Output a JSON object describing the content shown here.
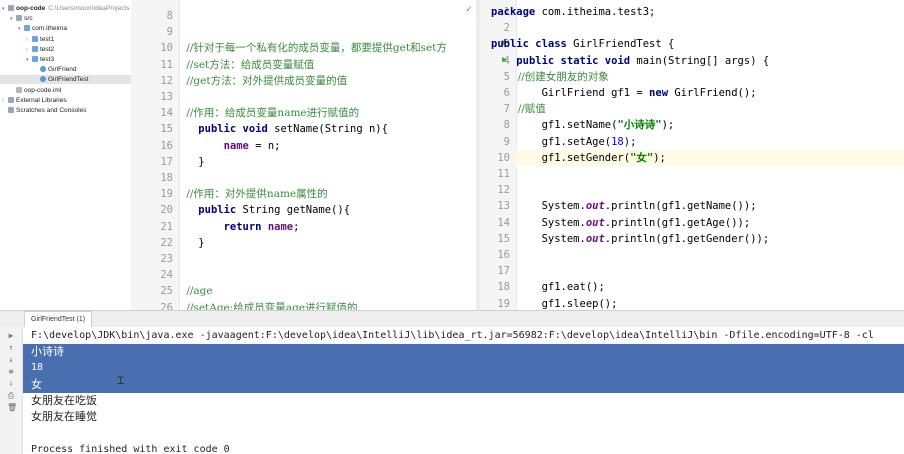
{
  "project_tree": {
    "items": [
      {
        "label": "oop-code",
        "path": "C:\\Users\\moon\\IdeaProjects",
        "indent": 0,
        "icon": "folder-icon",
        "arrow": "▾"
      },
      {
        "label": "src",
        "indent": 1,
        "icon": "folder-icon",
        "arrow": "▾"
      },
      {
        "label": "com.itheima",
        "indent": 2,
        "icon": "package-icon",
        "arrow": "▾"
      },
      {
        "label": "test1",
        "indent": 3,
        "icon": "package-icon",
        "arrow": "›"
      },
      {
        "label": "test2",
        "indent": 3,
        "icon": "package-icon",
        "arrow": "›"
      },
      {
        "label": "test3",
        "indent": 3,
        "icon": "package-icon",
        "arrow": "▾"
      },
      {
        "label": "GirlFriend",
        "indent": 4,
        "icon": "class-icon",
        "arrow": ""
      },
      {
        "label": "GirlFriendTest",
        "indent": 4,
        "icon": "class-icon",
        "arrow": "",
        "selected": true
      },
      {
        "label": "oop-code.iml",
        "indent": 1,
        "icon": "file-icon",
        "arrow": ""
      },
      {
        "label": "External Libraries",
        "indent": 0,
        "icon": "library-icon",
        "arrow": "›"
      },
      {
        "label": "Scratches and Consoles",
        "indent": 0,
        "icon": "scratch-icon",
        "arrow": ""
      }
    ]
  },
  "left_editor": {
    "line_numbers": [
      "8",
      "9",
      "10",
      "11",
      "12",
      "13",
      "14",
      "15",
      "16",
      "17",
      "18",
      "19",
      "20",
      "21",
      "22",
      "23",
      "24",
      "25",
      "26"
    ],
    "lines": [
      {
        "segs": []
      },
      {
        "segs": []
      },
      {
        "segs": [
          {
            "t": "    //针对于每一个私有化的成员变量，都要提供get和set方",
            "c": "cmz"
          }
        ]
      },
      {
        "segs": [
          {
            "t": "    //set方法：给成员变量赋值",
            "c": "cmz"
          }
        ]
      },
      {
        "segs": [
          {
            "t": "    //get方法：对外提供成员变量的值",
            "c": "cmz"
          }
        ]
      },
      {
        "segs": []
      },
      {
        "segs": [
          {
            "t": "    //作用：给成员变量name进行赋值的",
            "c": "cmz"
          }
        ]
      },
      {
        "segs": [
          {
            "t": "    ",
            "c": ""
          },
          {
            "t": "public void",
            "c": "kw"
          },
          {
            "t": " setName(String n){",
            "c": ""
          }
        ]
      },
      {
        "segs": [
          {
            "t": "        ",
            "c": ""
          },
          {
            "t": "name",
            "c": "fld"
          },
          {
            "t": " = n;",
            "c": ""
          }
        ]
      },
      {
        "segs": [
          {
            "t": "    }",
            "c": ""
          }
        ]
      },
      {
        "segs": []
      },
      {
        "segs": [
          {
            "t": "    //作用：对外提供name属性的",
            "c": "cmz"
          }
        ]
      },
      {
        "segs": [
          {
            "t": "    ",
            "c": ""
          },
          {
            "t": "public",
            "c": "kw"
          },
          {
            "t": " String getName(){",
            "c": ""
          }
        ]
      },
      {
        "segs": [
          {
            "t": "        ",
            "c": ""
          },
          {
            "t": "return",
            "c": "kw"
          },
          {
            "t": " ",
            "c": ""
          },
          {
            "t": "name",
            "c": "fld"
          },
          {
            "t": ";",
            "c": ""
          }
        ]
      },
      {
        "segs": [
          {
            "t": "    }",
            "c": ""
          }
        ]
      },
      {
        "segs": []
      },
      {
        "segs": []
      },
      {
        "segs": [
          {
            "t": "    //age",
            "c": "cmz"
          }
        ]
      },
      {
        "segs": [
          {
            "t": "    //setAge:给成员变量age进行赋值的",
            "c": "cmz"
          }
        ]
      }
    ]
  },
  "right_editor": {
    "line_numbers": [
      "1",
      "2",
      "3",
      "4",
      "5",
      "6",
      "7",
      "8",
      "9",
      "10",
      "11",
      "12",
      "13",
      "14",
      "15",
      "16",
      "17",
      "18",
      "19"
    ],
    "highlight_line_index": 9,
    "run_markers": [
      2,
      3
    ],
    "lines": [
      {
        "segs": [
          {
            "t": "package",
            "c": "kw"
          },
          {
            "t": " com.itheima.test3;",
            "c": ""
          }
        ]
      },
      {
        "segs": []
      },
      {
        "segs": [
          {
            "t": "public class",
            "c": "kw"
          },
          {
            "t": " GirlFriendTest {",
            "c": ""
          }
        ]
      },
      {
        "segs": [
          {
            "t": "    ",
            "c": ""
          },
          {
            "t": "public static void",
            "c": "kw"
          },
          {
            "t": " main(String[] args) {",
            "c": ""
          }
        ]
      },
      {
        "segs": [
          {
            "t": "        //创建女朋友的对象",
            "c": "cmz"
          }
        ]
      },
      {
        "segs": [
          {
            "t": "        GirlFriend gf1 = ",
            "c": ""
          },
          {
            "t": "new",
            "c": "kw"
          },
          {
            "t": " GirlFriend();",
            "c": ""
          }
        ]
      },
      {
        "segs": [
          {
            "t": "        //赋值",
            "c": "cmz"
          }
        ]
      },
      {
        "segs": [
          {
            "t": "        gf1.setName(",
            "c": ""
          },
          {
            "t": "\"小诗诗\"",
            "c": "str"
          },
          {
            "t": ");",
            "c": ""
          }
        ]
      },
      {
        "segs": [
          {
            "t": "        gf1.setAge(",
            "c": ""
          },
          {
            "t": "18",
            "c": "num"
          },
          {
            "t": ");",
            "c": ""
          }
        ]
      },
      {
        "segs": [
          {
            "t": "        gf1.setGender(",
            "c": ""
          },
          {
            "t": "\"女\"",
            "c": "str"
          },
          {
            "t": ");",
            "c": ""
          }
        ]
      },
      {
        "segs": []
      },
      {
        "segs": []
      },
      {
        "segs": [
          {
            "t": "        System.",
            "c": ""
          },
          {
            "t": "out",
            "c": "ita"
          },
          {
            "t": ".println(gf1.getName());",
            "c": ""
          }
        ]
      },
      {
        "segs": [
          {
            "t": "        System.",
            "c": ""
          },
          {
            "t": "out",
            "c": "ita"
          },
          {
            "t": ".println(gf1.getAge());",
            "c": ""
          }
        ]
      },
      {
        "segs": [
          {
            "t": "        System.",
            "c": ""
          },
          {
            "t": "out",
            "c": "ita"
          },
          {
            "t": ".println(gf1.getGender());",
            "c": ""
          }
        ]
      },
      {
        "segs": []
      },
      {
        "segs": []
      },
      {
        "segs": [
          {
            "t": "        gf1.eat();",
            "c": ""
          }
        ]
      },
      {
        "segs": [
          {
            "t": "        gf1.sleep();",
            "c": ""
          }
        ]
      }
    ]
  },
  "run_panel": {
    "tab_label": "GirlFriendTest (1)",
    "command": "F:\\develop\\JDK\\bin\\java.exe -javaagent:F:\\develop\\idea\\IntelliJ\\lib\\idea_rt.jar=56982:F:\\develop\\idea\\IntelliJ\\bin -Dfile.encoding=UTF-8 -cl",
    "output": [
      "小诗诗",
      "18",
      "女",
      "女朋友在吃饭",
      "女朋友在睡觉",
      "",
      "Process finished with exit code 0"
    ],
    "selected_lines": [
      0,
      1,
      2
    ],
    "tools": [
      "run-icon",
      "arrow-up-icon",
      "arrow-down-icon",
      "wrap-icon",
      "scroll-end-icon",
      "print-icon",
      "delete-icon"
    ]
  },
  "colors": {
    "selection": "#4a6fb0",
    "keyword": "#000080",
    "string": "#008000",
    "number": "#0000ff",
    "comment": "#3a8a3a",
    "current_line": "#fffae3"
  }
}
